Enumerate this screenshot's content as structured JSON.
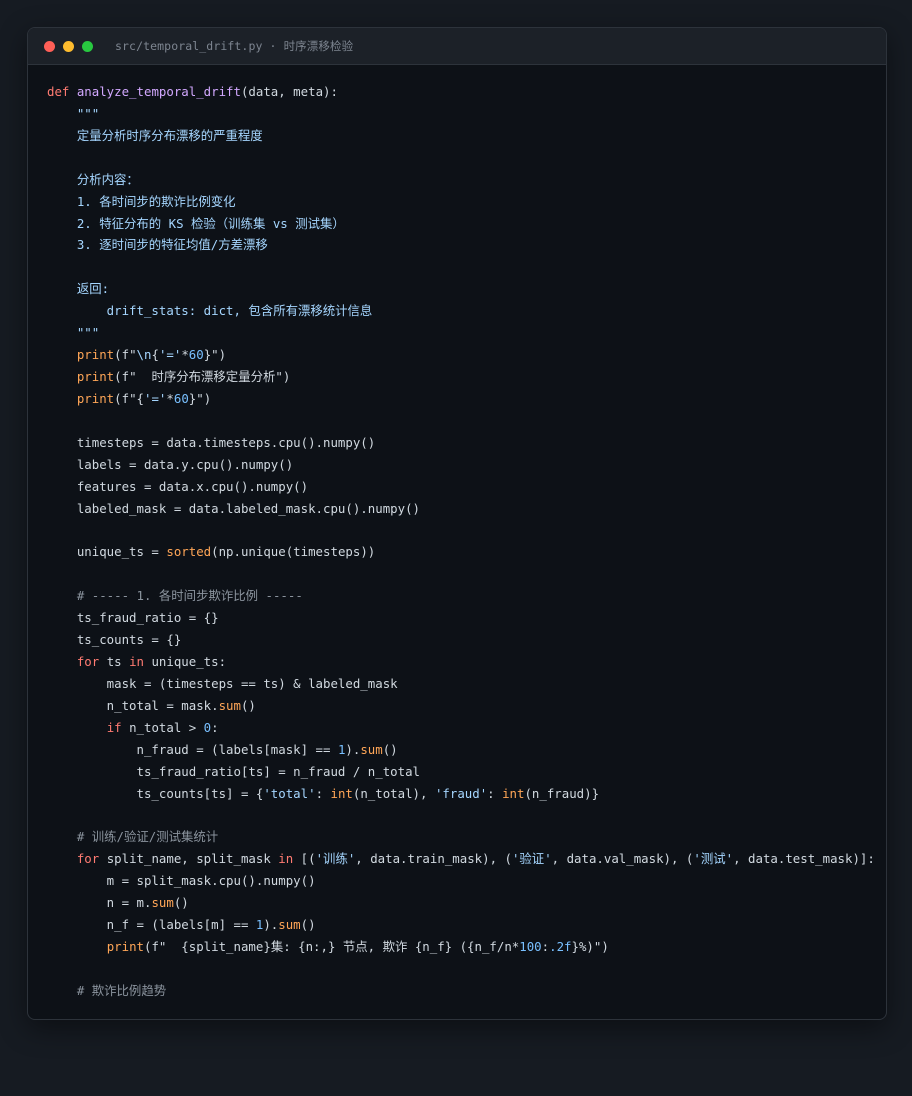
{
  "window": {
    "title": "src/temporal_drift.py · 时序漂移检验",
    "controls": [
      {
        "name": "close",
        "color": "#ff5f57"
      },
      {
        "name": "minimize",
        "color": "#febc2e"
      },
      {
        "name": "maximize",
        "color": "#28c840"
      }
    ]
  },
  "colors": {
    "keyword": "#ff7b72",
    "function": "#d2a8ff",
    "builtin": "#ffa657",
    "string": "#a5d6ff",
    "number": "#79c0ff",
    "comment": "#8b949e",
    "text": "#d1d9e0"
  },
  "code_lines": [
    [
      {
        "t": "kw",
        "v": "def "
      },
      {
        "t": "fn",
        "v": "analyze_temporal_drift"
      },
      {
        "t": "plain",
        "v": "(data, meta):"
      }
    ],
    [
      {
        "t": "str",
        "v": "    \"\"\""
      }
    ],
    [
      {
        "t": "str",
        "v": "    定量分析时序分布漂移的严重程度"
      }
    ],
    [],
    [
      {
        "t": "str",
        "v": "    分析内容："
      }
    ],
    [
      {
        "t": "str",
        "v": "    1. 各时间步的欺诈比例变化"
      }
    ],
    [
      {
        "t": "str",
        "v": "    2. 特征分布的 KS 检验（训练集 vs 测试集）"
      }
    ],
    [
      {
        "t": "str",
        "v": "    3. 逐时间步的特征均值/方差漂移"
      }
    ],
    [],
    [
      {
        "t": "str",
        "v": "    返回:"
      }
    ],
    [
      {
        "t": "str",
        "v": "        drift_stats: dict, 包含所有漂移统计信息"
      }
    ],
    [
      {
        "t": "str",
        "v": "    \"\"\""
      }
    ],
    [
      {
        "t": "plain",
        "v": "    "
      },
      {
        "t": "bi",
        "v": "print"
      },
      {
        "t": "plain",
        "v": "(f\""
      },
      {
        "t": "str",
        "v": "\\n"
      },
      {
        "t": "plain",
        "v": "{"
      },
      {
        "t": "str",
        "v": "'='"
      },
      {
        "t": "plain",
        "v": "*"
      },
      {
        "t": "num",
        "v": "60"
      },
      {
        "t": "plain",
        "v": "}\")"
      }
    ],
    [
      {
        "t": "plain",
        "v": "    "
      },
      {
        "t": "bi",
        "v": "print"
      },
      {
        "t": "plain",
        "v": "(f\"  时序分布漂移定量分析\")"
      }
    ],
    [
      {
        "t": "plain",
        "v": "    "
      },
      {
        "t": "bi",
        "v": "print"
      },
      {
        "t": "plain",
        "v": "(f\"{"
      },
      {
        "t": "str",
        "v": "'='"
      },
      {
        "t": "plain",
        "v": "*"
      },
      {
        "t": "num",
        "v": "60"
      },
      {
        "t": "plain",
        "v": "}\")"
      }
    ],
    [],
    [
      {
        "t": "plain",
        "v": "    timesteps = data.timesteps.cpu().numpy()"
      }
    ],
    [
      {
        "t": "plain",
        "v": "    labels = data.y.cpu().numpy()"
      }
    ],
    [
      {
        "t": "plain",
        "v": "    features = data.x.cpu().numpy()"
      }
    ],
    [
      {
        "t": "plain",
        "v": "    labeled_mask = data.labeled_mask.cpu().numpy()"
      }
    ],
    [],
    [
      {
        "t": "plain",
        "v": "    unique_ts = "
      },
      {
        "t": "bi",
        "v": "sorted"
      },
      {
        "t": "plain",
        "v": "(np.unique(timesteps))"
      }
    ],
    [],
    [
      {
        "t": "cm",
        "v": "    # ----- 1. 各时间步欺诈比例 -----"
      }
    ],
    [
      {
        "t": "plain",
        "v": "    ts_fraud_ratio = {}"
      }
    ],
    [
      {
        "t": "plain",
        "v": "    ts_counts = {}"
      }
    ],
    [
      {
        "t": "plain",
        "v": "    "
      },
      {
        "t": "kw",
        "v": "for"
      },
      {
        "t": "plain",
        "v": " ts "
      },
      {
        "t": "kw",
        "v": "in"
      },
      {
        "t": "plain",
        "v": " unique_ts:"
      }
    ],
    [
      {
        "t": "plain",
        "v": "        mask = (timesteps == ts) & labeled_mask"
      }
    ],
    [
      {
        "t": "plain",
        "v": "        n_total = mask."
      },
      {
        "t": "bi",
        "v": "sum"
      },
      {
        "t": "plain",
        "v": "()"
      }
    ],
    [
      {
        "t": "plain",
        "v": "        "
      },
      {
        "t": "kw",
        "v": "if"
      },
      {
        "t": "plain",
        "v": " n_total > "
      },
      {
        "t": "num",
        "v": "0"
      },
      {
        "t": "plain",
        "v": ":"
      }
    ],
    [
      {
        "t": "plain",
        "v": "            n_fraud = (labels[mask] == "
      },
      {
        "t": "num",
        "v": "1"
      },
      {
        "t": "plain",
        "v": ")."
      },
      {
        "t": "bi",
        "v": "sum"
      },
      {
        "t": "plain",
        "v": "()"
      }
    ],
    [
      {
        "t": "plain",
        "v": "            ts_fraud_ratio[ts] = n_fraud / n_total"
      }
    ],
    [
      {
        "t": "plain",
        "v": "            ts_counts[ts] = {"
      },
      {
        "t": "str",
        "v": "'total'"
      },
      {
        "t": "plain",
        "v": ": "
      },
      {
        "t": "bi",
        "v": "int"
      },
      {
        "t": "plain",
        "v": "(n_total), "
      },
      {
        "t": "str",
        "v": "'fraud'"
      },
      {
        "t": "plain",
        "v": ": "
      },
      {
        "t": "bi",
        "v": "int"
      },
      {
        "t": "plain",
        "v": "(n_fraud)}"
      }
    ],
    [],
    [
      {
        "t": "cm",
        "v": "    # 训练/验证/测试集统计"
      }
    ],
    [
      {
        "t": "plain",
        "v": "    "
      },
      {
        "t": "kw",
        "v": "for"
      },
      {
        "t": "plain",
        "v": " split_name, split_mask "
      },
      {
        "t": "kw",
        "v": "in"
      },
      {
        "t": "plain",
        "v": " [("
      },
      {
        "t": "str",
        "v": "'训练'"
      },
      {
        "t": "plain",
        "v": ", data.train_mask), ("
      },
      {
        "t": "str",
        "v": "'验证'"
      },
      {
        "t": "plain",
        "v": ", data.val_mask), ("
      },
      {
        "t": "str",
        "v": "'测试'"
      },
      {
        "t": "plain",
        "v": ", data.test_mask)]:"
      }
    ],
    [
      {
        "t": "plain",
        "v": "        m = split_mask.cpu().numpy()"
      }
    ],
    [
      {
        "t": "plain",
        "v": "        n = m."
      },
      {
        "t": "bi",
        "v": "sum"
      },
      {
        "t": "plain",
        "v": "()"
      }
    ],
    [
      {
        "t": "plain",
        "v": "        n_f = (labels[m] == "
      },
      {
        "t": "num",
        "v": "1"
      },
      {
        "t": "plain",
        "v": ")."
      },
      {
        "t": "bi",
        "v": "sum"
      },
      {
        "t": "plain",
        "v": "()"
      }
    ],
    [
      {
        "t": "plain",
        "v": "        "
      },
      {
        "t": "bi",
        "v": "print"
      },
      {
        "t": "plain",
        "v": "(f\"  {split_name}集: {n:,} 节点, 欺诈 {n_f} ({n_f/n*"
      },
      {
        "t": "num",
        "v": "100"
      },
      {
        "t": "plain",
        "v": ":"
      },
      {
        "t": "num",
        "v": ".2f"
      },
      {
        "t": "plain",
        "v": "}%)\")"
      }
    ],
    [],
    [
      {
        "t": "cm",
        "v": "    # 欺诈比例趋势"
      }
    ]
  ]
}
